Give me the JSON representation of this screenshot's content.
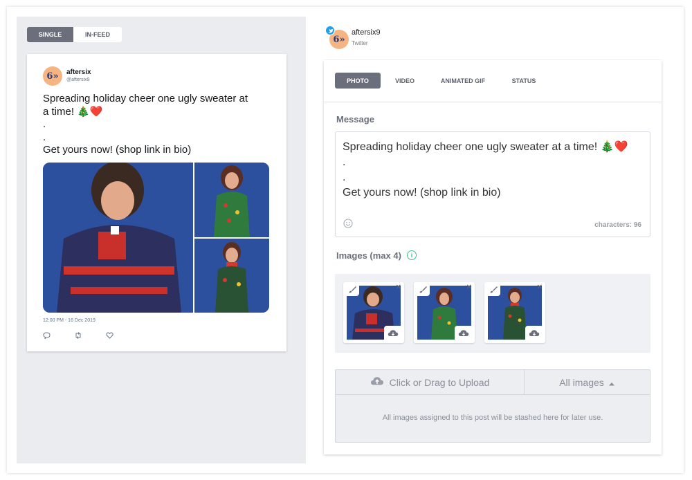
{
  "preview": {
    "toggle": {
      "single": "SINGLE",
      "in_feed": "IN-FEED"
    },
    "tweet": {
      "avatar_text": "6»",
      "name": "aftersix",
      "handle": "@aftersix9",
      "lines": [
        "Spreading holiday cheer one ugly sweater at",
        "a time! 🎄❤️",
        ".",
        ".",
        "Get yours now! (shop link in bio)"
      ],
      "timestamp": "12:00 PM - 16 Dec 2019",
      "icons": [
        "reply-icon",
        "retweet-icon",
        "like-icon"
      ]
    }
  },
  "account": {
    "avatar_text": "6»",
    "name": "aftersix9",
    "network": "Twitter"
  },
  "composer": {
    "tabs": [
      "PHOTO",
      "VIDEO",
      "ANIMATED GIF",
      "STATUS"
    ],
    "active_tab": "PHOTO",
    "message_label": "Message",
    "message_lines": [
      "Spreading holiday cheer one ugly sweater at a time! 🎄❤️",
      ".",
      ".",
      "Get yours now! (shop link in bio)"
    ],
    "characters": "characters: 96",
    "images_label": "Images (max 4)",
    "images": [
      {
        "alt": "woman-laughing-sweater"
      },
      {
        "alt": "woman-lights-sweater"
      },
      {
        "alt": "woman-ornament-sweater"
      }
    ],
    "upload_label": "Click or Drag to Upload",
    "all_images_label": "All images",
    "stash_text": "All images assigned to this post will be stashed here for later use."
  },
  "colors": {
    "accent_tab": "#6b6f7c",
    "twitter": "#1da1f2",
    "info": "#3ec28f",
    "photo_bg": "#2b4e9c"
  }
}
